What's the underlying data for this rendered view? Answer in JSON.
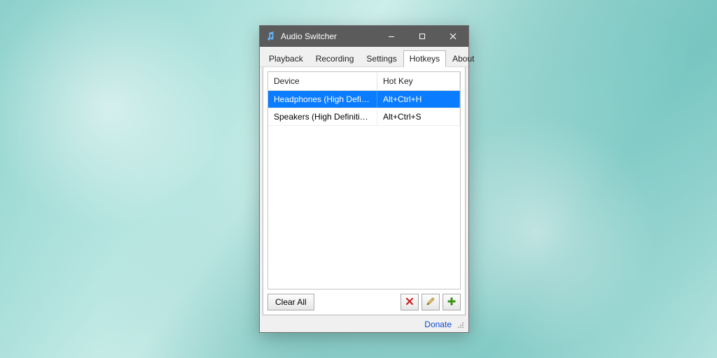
{
  "window": {
    "title": "Audio Switcher"
  },
  "tabs": [
    {
      "label": "Playback",
      "active": false
    },
    {
      "label": "Recording",
      "active": false
    },
    {
      "label": "Settings",
      "active": false
    },
    {
      "label": "Hotkeys",
      "active": true
    },
    {
      "label": "About",
      "active": false
    }
  ],
  "listview": {
    "headers": {
      "device": "Device",
      "hotkey": "Hot Key"
    },
    "rows": [
      {
        "device": "Headphones (High Definitio...",
        "hotkey": "Alt+Ctrl+H",
        "selected": true
      },
      {
        "device": "Speakers (High Definition A...",
        "hotkey": "Alt+Ctrl+S",
        "selected": false
      }
    ]
  },
  "toolbar": {
    "clear_all_label": "Clear All"
  },
  "footer": {
    "donate_label": "Donate"
  },
  "colors": {
    "selection": "#0a7cff",
    "titlebar": "#5b5b5b",
    "link": "#0a49d6"
  }
}
